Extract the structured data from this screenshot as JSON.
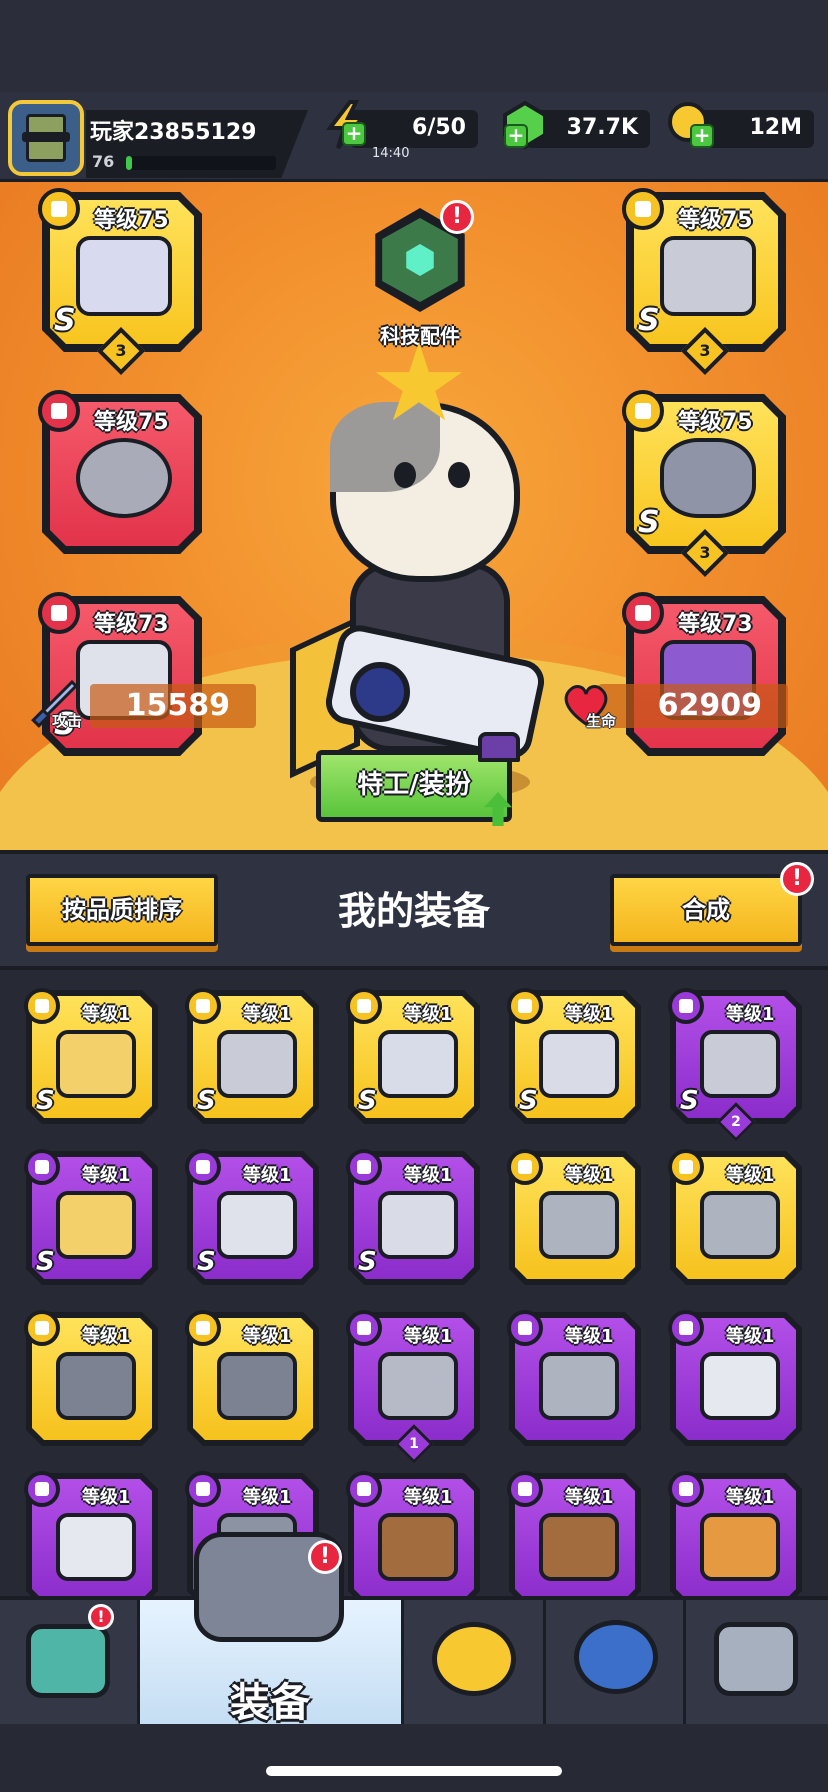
{
  "player": {
    "name": "玩家23855129",
    "level": "76",
    "xp_fraction": 0.04
  },
  "resources": {
    "energy": {
      "value": "6/50",
      "timer": "14:40",
      "icon": "lightning-icon"
    },
    "gems": {
      "value": "37.7K",
      "icon": "green-gem-icon"
    },
    "coins": {
      "value": "12M",
      "icon": "gold-coin-icon"
    }
  },
  "equipped": {
    "weapon": {
      "level": "等级75",
      "grade": "S",
      "count": "3",
      "icon": "blaster-gun-icon"
    },
    "armor": {
      "level": "等级75",
      "grade": "S",
      "count": "3",
      "icon": "armor-vest-icon"
    },
    "necklace": {
      "level": "等级75",
      "icon": "spiked-collar-icon"
    },
    "belt": {
      "level": "等级75",
      "grade": "S",
      "count": "3",
      "icon": "belt-icon"
    },
    "gloves": {
      "level": "等级73",
      "grade": "S",
      "icon": "mech-gauntlet-icon"
    },
    "boots": {
      "level": "等级73",
      "icon": "sneaker-icon"
    }
  },
  "tech_parts": {
    "label": "科技配件",
    "alert": "!"
  },
  "stats": {
    "attack": {
      "label": "攻击",
      "value": "15589"
    },
    "health": {
      "label": "生命",
      "value": "62909"
    }
  },
  "agent_button": "特工/装扮",
  "inventory": {
    "title": "我的装备",
    "sort_button": "按品质排序",
    "merge_button": "合成",
    "merge_alert": "!",
    "items": [
      {
        "level": "等级1",
        "rarity": "gold",
        "grade": "S",
        "icon": "sword-icon"
      },
      {
        "level": "等级1",
        "rarity": "gold",
        "grade": "S",
        "icon": "armor-vest-icon"
      },
      {
        "level": "等级1",
        "rarity": "gold",
        "grade": "S",
        "icon": "star-necklace-icon"
      },
      {
        "level": "等级1",
        "rarity": "gold",
        "grade": "S",
        "icon": "sneaker-icon"
      },
      {
        "level": "等级1",
        "rarity": "purple",
        "grade": "S",
        "count": "2",
        "icon": "armor-vest-icon"
      },
      {
        "level": "等级1",
        "rarity": "purple",
        "grade": "S",
        "icon": "sword-icon"
      },
      {
        "level": "等级1",
        "rarity": "purple",
        "grade": "S",
        "icon": "mech-gauntlet-icon"
      },
      {
        "level": "等级1",
        "rarity": "purple",
        "grade": "S",
        "icon": "sneaker-icon"
      },
      {
        "level": "等级1",
        "rarity": "gold",
        "icon": "kunai-icon"
      },
      {
        "level": "等级1",
        "rarity": "gold",
        "icon": "kunai-icon"
      },
      {
        "level": "等级1",
        "rarity": "gold",
        "icon": "star-belt-icon"
      },
      {
        "level": "等级1",
        "rarity": "gold",
        "icon": "star-belt-icon"
      },
      {
        "level": "等级1",
        "rarity": "purple",
        "count": "1",
        "icon": "plate-armor-icon"
      },
      {
        "level": "等级1",
        "rarity": "purple",
        "icon": "kunai-icon"
      },
      {
        "level": "等级1",
        "rarity": "purple",
        "icon": "machete-icon"
      },
      {
        "level": "等级1",
        "rarity": "purple",
        "icon": "machete-icon"
      },
      {
        "level": "等级1",
        "rarity": "purple",
        "icon": "revolver-icon"
      },
      {
        "level": "等级1",
        "rarity": "purple",
        "icon": "shotgun-icon"
      },
      {
        "level": "等级1",
        "rarity": "purple",
        "icon": "shotgun-icon"
      },
      {
        "level": "等级1",
        "rarity": "purple",
        "icon": "torch-icon"
      }
    ]
  },
  "nav": {
    "tabs": [
      {
        "icon": "shop-icon",
        "alert": "!"
      },
      {
        "icon": "revolver-icon",
        "label": "装备",
        "alert": "!"
      },
      {
        "icon": "crossed-swords-star-icon"
      },
      {
        "icon": "star-ball-icon"
      },
      {
        "icon": "dna-capsule-icon"
      }
    ]
  },
  "colors": {
    "gold": "#f8c51f",
    "purple": "#9a3ad8",
    "red": "#e2334a",
    "orange_bg": "#f18d2c",
    "green": "#58c43b"
  }
}
